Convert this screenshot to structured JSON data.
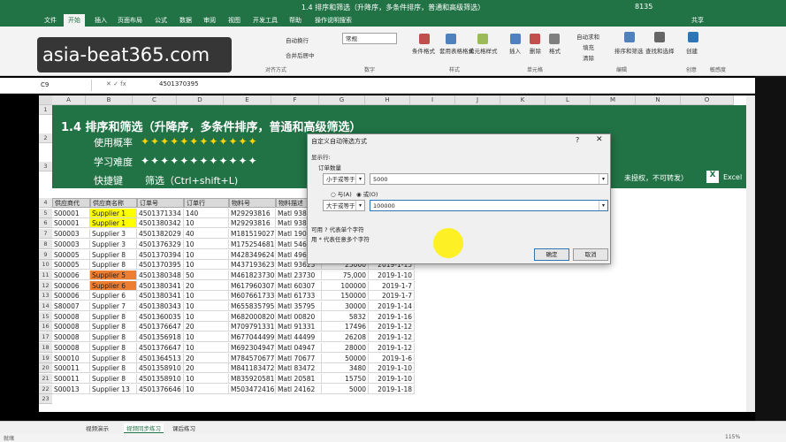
{
  "title": "1.4 排序和筛选（升降序，多条件排序，普通和高级筛选）",
  "account": "8135",
  "share": "共享",
  "tabs": [
    "文件",
    "开始",
    "插入",
    "页面布局",
    "公式",
    "数据",
    "审阅",
    "视图",
    "开发工具",
    "帮助",
    "操作说明搜索"
  ],
  "ribbon": {
    "wrap": "自动换行",
    "merge": "合并后居中",
    "format_value": "常规",
    "cond_format": "条件格式",
    "table_format": "套用表格格式",
    "cell_style": "单元格样式",
    "insert": "插入",
    "delete": "删除",
    "format": "格式",
    "autosum": "自动求和",
    "fill": "填充",
    "clear": "清除",
    "sort_filter": "排序和筛选",
    "find_select": "查找和选择",
    "create": "创建",
    "groups": {
      "align": "对齐方式",
      "number": "数字",
      "styles": "样式",
      "cells": "单元格",
      "edit": "编辑",
      "create": "创意",
      "sens": "敏感度"
    }
  },
  "watermark": "asia-beat365.com",
  "brand_bg": "#217346",
  "name_box": "C9",
  "formula_value": "4501370395",
  "columns": [
    "A",
    "B",
    "C",
    "D",
    "E",
    "F",
    "G",
    "H",
    "I",
    "J",
    "K",
    "L",
    "M",
    "N",
    "O"
  ],
  "banner": {
    "title": "1.4 排序和筛选（升降序，多条件排序，普通和高级筛选）",
    "use_label": "使用概率",
    "use_stars": "✦✦✦✦✦✦✦✦✦✦✦✦",
    "diff_label": "学习难度",
    "diff_stars": "✦✦✦✦✦✦✦✦✦✦✦✦",
    "shortcut_label": "快捷键",
    "shortcut": "筛选（Ctrl+shift+L)",
    "copyright": "未授权，不可转发）",
    "excel": "Excel"
  },
  "headers": [
    "供应商代",
    "供应商名称",
    "订单号",
    "订单行",
    "物料号",
    "物料描述"
  ],
  "row_numbers": [
    "1",
    "2",
    "3",
    "4",
    "5",
    "6",
    "7",
    "8",
    "9",
    "10",
    "11",
    "12",
    "13",
    "14",
    "15",
    "16",
    "17",
    "18",
    "19",
    "20",
    "21",
    "22",
    "23"
  ],
  "rows": [
    {
      "a": "S00001",
      "b": "Supplier 1",
      "c": "4501371334",
      "d": "140",
      "e": "M29293816",
      "f": "Matl 938",
      "g": "",
      "h": ""
    },
    {
      "a": "S00001",
      "b": "Supplier 1",
      "c": "4501380342",
      "d": "10",
      "e": "M29293816",
      "f": "Matl 938",
      "g": "",
      "h": ""
    },
    {
      "a": "S00003",
      "b": "Supplier 3",
      "c": "4501382029",
      "d": "40",
      "e": "M181519027",
      "f": "Matl 190",
      "g": "",
      "h": ""
    },
    {
      "a": "S00003",
      "b": "Supplier 3",
      "c": "4501376329",
      "d": "10",
      "e": "M175254681",
      "f": "Matl 546",
      "g": "",
      "h": ""
    },
    {
      "a": "S00005",
      "b": "Supplier 8",
      "c": "4501370394",
      "d": "10",
      "e": "M428349624",
      "f": "Matl 496",
      "g": "",
      "h": ""
    },
    {
      "a": "S00005",
      "b": "Supplier 8",
      "c": "4501370395",
      "d": "10",
      "e": "M437193623",
      "f": "Matl 93623",
      "g": "25000",
      "h": "2019-1-15"
    },
    {
      "a": "S00006",
      "b": "Supplier 5",
      "c": "4501380348",
      "d": "50",
      "e": "M461823730",
      "f": "Matl 23730",
      "g": "75,000",
      "h": "2019-1-10"
    },
    {
      "a": "S00006",
      "b": "Supplier 6",
      "c": "4501380341",
      "d": "20",
      "e": "M617960307",
      "f": "Matl 60307",
      "g": "100000",
      "h": "2019-1-7"
    },
    {
      "a": "S00006",
      "b": "Supplier 6",
      "c": "4501380341",
      "d": "10",
      "e": "M607661733",
      "f": "Matl 61733",
      "g": "150000",
      "h": "2019-1-7"
    },
    {
      "a": "S80007",
      "b": "Supplier 7",
      "c": "4501380343",
      "d": "10",
      "e": "M655835795",
      "f": "Matl 35795",
      "g": "30000",
      "h": "2019-1-14"
    },
    {
      "a": "S00008",
      "b": "Supplier 8",
      "c": "4501360035",
      "d": "10",
      "e": "M682000820",
      "f": "Matl 00820",
      "g": "5832",
      "h": "2019-1-16"
    },
    {
      "a": "S00008",
      "b": "Supplier 8",
      "c": "4501376647",
      "d": "20",
      "e": "M709791331",
      "f": "Matl 91331",
      "g": "17496",
      "h": "2019-1-12"
    },
    {
      "a": "S00008",
      "b": "Supplier 8",
      "c": "4501356918",
      "d": "10",
      "e": "M677044499",
      "f": "Matl 44499",
      "g": "26208",
      "h": "2019-1-12"
    },
    {
      "a": "S00008",
      "b": "Supplier 8",
      "c": "4501376647",
      "d": "10",
      "e": "M692304947",
      "f": "Matl 04947",
      "g": "28000",
      "h": "2019-1-12"
    },
    {
      "a": "S00010",
      "b": "Supplier 8",
      "c": "4501364513",
      "d": "20",
      "e": "M784570677",
      "f": "Matl 70677",
      "g": "50000",
      "h": "2019-1-6"
    },
    {
      "a": "S00011",
      "b": "Supplier 8",
      "c": "4501358910",
      "d": "20",
      "e": "M841183472",
      "f": "Matl 83472",
      "g": "3480",
      "h": "2019-1-10"
    },
    {
      "a": "S00011",
      "b": "Supplier 8",
      "c": "4501358910",
      "d": "10",
      "e": "M835920581",
      "f": "Matl 20581",
      "g": "15750",
      "h": "2019-1-10"
    },
    {
      "a": "S00013",
      "b": "Supplier 13",
      "c": "4501376646",
      "d": "10",
      "e": "M503472416",
      "f": "Matl 24162",
      "g": "5000",
      "h": "2019-1-18"
    }
  ],
  "dialog": {
    "title": "自定义自动筛选方式",
    "show_rows": "显示行:",
    "field": "订单数量",
    "op1": "小于或等于",
    "val1": "5000",
    "and": "与(A)",
    "or": "或(O)",
    "op2": "大于或等于",
    "val2": "100000",
    "hint1": "可用 ? 代表单个字符",
    "hint2": "用 * 代表任意多个字符",
    "ok": "确定",
    "cancel": "取消"
  },
  "sheets": [
    "视频演示",
    "视频同步练习",
    "课后练习"
  ],
  "status": "就绪",
  "zoom": "115%"
}
